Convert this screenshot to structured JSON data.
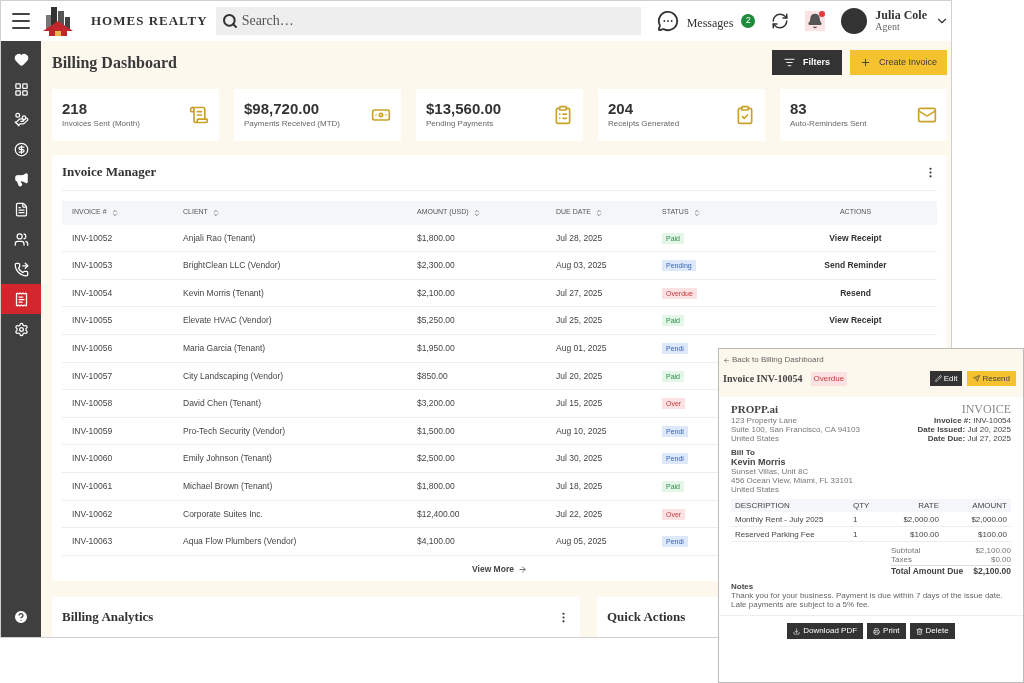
{
  "header": {
    "brand": "HOMES REALTY",
    "search": {
      "placeholder": "Search…"
    },
    "messages": {
      "label": "Messages",
      "count": "2"
    },
    "notifications": {
      "unread": true
    },
    "user": {
      "name": "Julia Cole",
      "role": "Agent"
    }
  },
  "sidebar": {
    "items": [
      {
        "selected": false
      },
      {
        "selected": false
      },
      {
        "selected": false
      },
      {
        "selected": false
      },
      {
        "selected": false
      },
      {
        "selected": false
      },
      {
        "selected": false
      },
      {
        "selected": false
      },
      {
        "selected": true
      },
      {
        "selected": false
      }
    ]
  },
  "page": {
    "title": "Billing Dashboard",
    "buttons": [
      "Filters",
      "Create Invoice"
    ]
  },
  "stats": [
    {
      "value": "218",
      "label": "Invoices Sent (Month)"
    },
    {
      "value": "$98,720.00",
      "label": "Payments Received (MTD)"
    },
    {
      "value": "$13,560.00",
      "label": "Pending Payments"
    },
    {
      "value": "204",
      "label": "Receipts Generated"
    },
    {
      "value": "83",
      "label": "Auto-Reminders Sent"
    }
  ],
  "invoice_manager": {
    "title": "Invoice Manager",
    "columns": [
      {
        "label": "INVOICE #",
        "sortable": true
      },
      {
        "label": "CLIENT",
        "sortable": true
      },
      {
        "label": "AMOUNT (USD)",
        "sortable": true
      },
      {
        "label": "DUE DATE",
        "sortable": true
      },
      {
        "label": "STATUS",
        "sortable": true
      },
      {
        "label": "ACTIONS",
        "sortable": false
      }
    ],
    "rows": [
      {
        "invoice": "INV-10052",
        "client": "Anjali Rao (Tenant)",
        "amount": "$1,800.00",
        "due": "Jul 28, 2025",
        "status": {
          "text": "Paid",
          "kind": "paid"
        },
        "action": "View Receipt"
      },
      {
        "invoice": "INV-10053",
        "client": "BrightClean LLC (Vendor)",
        "amount": "$2,300.00",
        "due": "Aug 03, 2025",
        "status": {
          "text": "Pending",
          "kind": "pending"
        },
        "action": "Send Reminder"
      },
      {
        "invoice": "INV-10054",
        "client": "Kevin Morris (Tenant)",
        "amount": "$2,100.00",
        "due": "Jul 27, 2025",
        "status": {
          "text": "Overdue",
          "kind": "overdue"
        },
        "action": "Resend"
      },
      {
        "invoice": "INV-10055",
        "client": "Elevate HVAC (Vendor)",
        "amount": "$5,250.00",
        "due": "Jul 25, 2025",
        "status": {
          "text": "Paid",
          "kind": "paid"
        },
        "action": "View Receipt"
      },
      {
        "invoice": "INV-10056",
        "client": "Maria Garcia (Tenant)",
        "amount": "$1,950.00",
        "due": "Aug 01, 2025",
        "status": {
          "text": "Pendi",
          "kind": "pending"
        }
      },
      {
        "invoice": "INV-10057",
        "client": "City Landscaping (Vendor)",
        "amount": "$850.00",
        "due": "Jul 20, 2025",
        "status": {
          "text": "Paid",
          "kind": "paid"
        }
      },
      {
        "invoice": "INV-10058",
        "client": "David Chen (Tenant)",
        "amount": "$3,200.00",
        "due": "Jul 15, 2025",
        "status": {
          "text": "Over",
          "kind": "overdue"
        }
      },
      {
        "invoice": "INV-10059",
        "client": "Pro-Tech Security (Vendor)",
        "amount": "$1,500.00",
        "due": "Aug 10, 2025",
        "status": {
          "text": "Pendi",
          "kind": "pending"
        }
      },
      {
        "invoice": "INV-10060",
        "client": "Emily Johnson (Tenant)",
        "amount": "$2,500.00",
        "due": "Jul 30, 2025",
        "status": {
          "text": "Pendi",
          "kind": "pending"
        }
      },
      {
        "invoice": "INV-10061",
        "client": "Michael Brown (Tenant)",
        "amount": "$1,800.00",
        "due": "Jul 18, 2025",
        "status": {
          "text": "Paid",
          "kind": "paid"
        }
      },
      {
        "invoice": "INV-10062",
        "client": "Corporate Suites Inc.",
        "amount": "$12,400.00",
        "due": "Jul 22, 2025",
        "status": {
          "text": "Over",
          "kind": "overdue"
        }
      },
      {
        "invoice": "INV-10063",
        "client": "Aqua Flow Plumbers (Vendor)",
        "amount": "$4,100.00",
        "due": "Aug 05, 2025",
        "status": {
          "text": "Pendi",
          "kind": "pending"
        }
      }
    ],
    "view_more": "View More"
  },
  "bottom_cards": [
    {
      "title": "Billing Analytics",
      "menu": true
    },
    {
      "title": "Quick Actions",
      "menu": false
    }
  ],
  "invoice_detail": {
    "back": "Back to Billing Dashboard",
    "title": "Invoice INV-10054",
    "status": {
      "text": "Overdue",
      "kind": "overdue"
    },
    "buttons": [
      "Edit",
      "Resend"
    ],
    "company": {
      "name": "PROPP.ai",
      "address": [
        "123 Property Lane",
        "Suite 100, San Francisco, CA 94103",
        "United States"
      ]
    },
    "doc_title": "INVOICE",
    "meta": [
      {
        "label": "Invoice #:",
        "value": "INV-10054"
      },
      {
        "label": "Date Issued:",
        "value": "Jul 20, 2025"
      },
      {
        "label": "Date Due:",
        "value": "Jul 27, 2025"
      }
    ],
    "bill_to": {
      "label": "Bill To",
      "name": "Kevin Morris",
      "address": [
        "Sunset Villas, Unit 8C",
        "456 Ocean View, Miami, FL 33101",
        "United States"
      ]
    },
    "columns": [
      "DESCRIPTION",
      "QTY",
      "RATE",
      "AMOUNT"
    ],
    "items": [
      {
        "description": "Monthly Rent - July 2025",
        "qty": "1",
        "rate": "$2,000.00",
        "amount": "$2,000.00"
      },
      {
        "description": "Reserved Parking Fee",
        "qty": "1",
        "rate": "$100.00",
        "amount": "$100.00"
      }
    ],
    "totals": [
      {
        "label": "Subtotal",
        "value": "$2,100.00"
      },
      {
        "label": "Taxes",
        "value": "$0.00"
      }
    ],
    "total_due": {
      "label": "Total Amount Due",
      "value": "$2,100.00"
    },
    "notes": {
      "label": "Notes",
      "text": "Thank you for your business. Payment is due within 7 days of the issue date. Late payments are subject to a 5% fee."
    },
    "actions": [
      "Download PDF",
      "Print",
      "Delete"
    ]
  }
}
